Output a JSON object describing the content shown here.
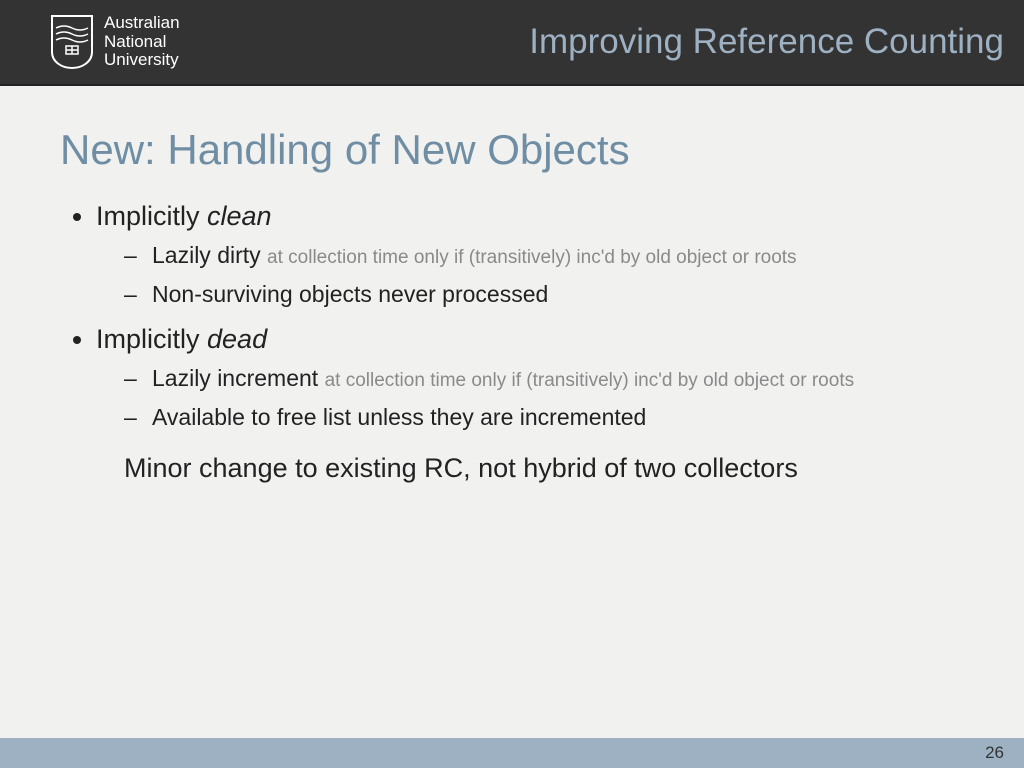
{
  "header": {
    "uni_line1": "Australian",
    "uni_line2": "National",
    "uni_line3": "University",
    "title": "Improving Reference Counting"
  },
  "slide": {
    "title": "New: Handling of New Objects",
    "b1_prefix": "Implicitly ",
    "b1_em": "clean",
    "b1_s1_a": "Lazily ",
    "b1_s1_b": "dirty ",
    "b1_s1_note": "at collection time only if (transitively) inc'd by old object or roots",
    "b1_s2": "Non-surviving objects never processed",
    "b2_prefix": "Implicitly ",
    "b2_em": "dead",
    "b2_s1_a": "Lazily increment ",
    "b2_s1_note": "at collection time only if (transitively) inc'd by old object or roots",
    "b2_s2": "Available to free list unless they are incremented",
    "summary": "Minor change to existing RC, not hybrid of two collectors"
  },
  "footer": {
    "page": "26"
  }
}
